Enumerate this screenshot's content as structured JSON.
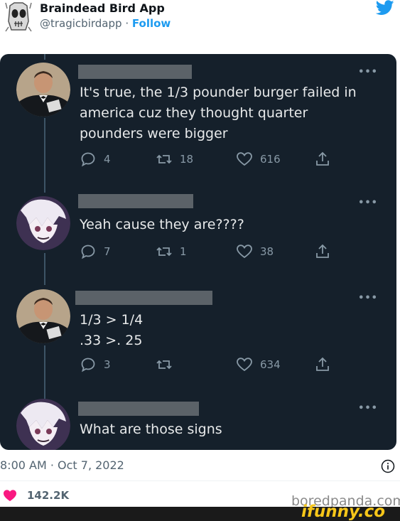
{
  "embed": {
    "app_name": "Braindead Bird App",
    "handle": "@tragicbirdapp",
    "separator": "·",
    "follow_label": "Follow",
    "brand_color": "#1d9bf0"
  },
  "thread": [
    {
      "avatar": "man-in-tuxedo-avatar",
      "text_lines": [
        "It's true, the 1/3 pounder burger failed in",
        "america cuz they thought quarter",
        "pounders were bigger"
      ],
      "more": "•••",
      "replies": "4",
      "retweets": "18",
      "likes": "616"
    },
    {
      "avatar": "anime-character-avatar",
      "text_lines": [
        "Yeah cause they are????"
      ],
      "more": "•••",
      "replies": "7",
      "retweets": "1",
      "likes": "38"
    },
    {
      "avatar": "man-in-tuxedo-avatar",
      "text_lines": [
        "1/3 > 1/4",
        ".33 >. 25"
      ],
      "more": "•••",
      "replies": "3",
      "retweets": "",
      "likes": "634"
    },
    {
      "avatar": "anime-character-avatar",
      "text_lines": [
        "What are those signs"
      ],
      "more": "•••"
    }
  ],
  "footer": {
    "timestamp": "8:00 AM · Oct 7, 2022",
    "like_count": "142.2K"
  },
  "watermarks": {
    "boredpanda": "boredpanda.com",
    "ifunny": "ifunny.co"
  }
}
